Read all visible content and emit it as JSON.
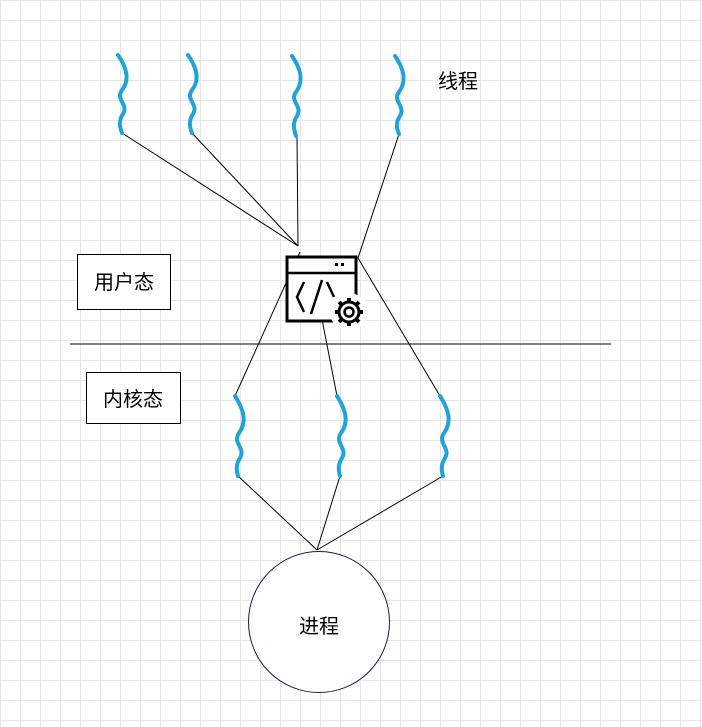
{
  "labels": {
    "thread": "线程",
    "user_mode": "用户态",
    "kernel_mode": "内核态",
    "process": "进程"
  },
  "colors": {
    "thread_wave": "#1fa3d8",
    "line": "#000000",
    "process_border": "#1a1a4d",
    "grid": "#e6e6e6"
  },
  "icons": {
    "scheduler": "code-window-gear-icon"
  }
}
